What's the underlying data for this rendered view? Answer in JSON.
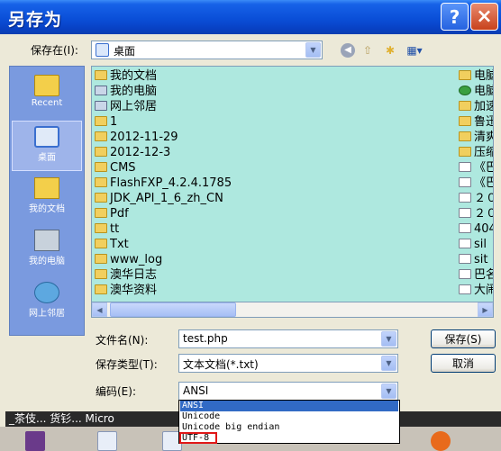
{
  "window": {
    "title": "另存为",
    "help_icon": "?",
    "close_icon": "×"
  },
  "save_in": {
    "label": "保存在(I):",
    "value": "桌面"
  },
  "places": [
    {
      "label": "Recent",
      "icon": "recent-icon"
    },
    {
      "label": "桌面",
      "icon": "desktop-icon"
    },
    {
      "label": "我的文档",
      "icon": "my-documents-icon"
    },
    {
      "label": "我的电脑",
      "icon": "my-computer-icon"
    },
    {
      "label": "网上邻居",
      "icon": "network-places-icon"
    }
  ],
  "files_col1": [
    {
      "name": "我的文档",
      "icon": "folder-special"
    },
    {
      "name": "我的电脑",
      "icon": "computer"
    },
    {
      "name": "网上邻居",
      "icon": "network"
    },
    {
      "name": "1",
      "icon": "folder"
    },
    {
      "name": "2012-11-29",
      "icon": "folder"
    },
    {
      "name": "2012-12-3",
      "icon": "folder"
    },
    {
      "name": "CMS",
      "icon": "folder"
    },
    {
      "name": "FlashFXP_4.2.4.1785",
      "icon": "folder"
    },
    {
      "name": "JDK_API_1_6_zh_CN",
      "icon": "folder"
    },
    {
      "name": "Pdf",
      "icon": "folder"
    },
    {
      "name": "tt",
      "icon": "folder"
    },
    {
      "name": "Txt",
      "icon": "folder"
    },
    {
      "name": "www_log",
      "icon": "folder"
    },
    {
      "name": "澳华日志",
      "icon": "folder"
    },
    {
      "name": "澳华资料",
      "icon": "folder"
    }
  ],
  "files_col2": [
    {
      "name": "电脑",
      "icon": "folder"
    },
    {
      "name": "电脑",
      "icon": "tree"
    },
    {
      "name": "加速",
      "icon": "folder"
    },
    {
      "name": "鲁迅",
      "icon": "folder"
    },
    {
      "name": "清爽",
      "icon": "folder"
    },
    {
      "name": "压缩",
      "icon": "folder"
    },
    {
      "name": "《巴",
      "icon": "document"
    },
    {
      "name": "《巴",
      "icon": "document"
    },
    {
      "name": "２０",
      "icon": "document"
    },
    {
      "name": "２０",
      "icon": "document"
    },
    {
      "name": "404",
      "icon": "document"
    },
    {
      "name": "sil",
      "icon": "document"
    },
    {
      "name": "sit",
      "icon": "document"
    },
    {
      "name": "巴名",
      "icon": "document"
    },
    {
      "name": "大闹",
      "icon": "document"
    }
  ],
  "form": {
    "filename_label": "文件名(N):",
    "filename_value": "test.php",
    "filetype_label": "保存类型(T):",
    "filetype_value": "文本文档(*.txt)",
    "encoding_label": "编码(E):",
    "encoding_value": "ANSI"
  },
  "buttons": {
    "save": "保存(S)",
    "cancel": "取消"
  },
  "encoding_options": [
    "ANSI",
    "Unicode",
    "Unicode big endian",
    "UTF-8"
  ],
  "background_text": "_茶伎... 货钐... Micro"
}
